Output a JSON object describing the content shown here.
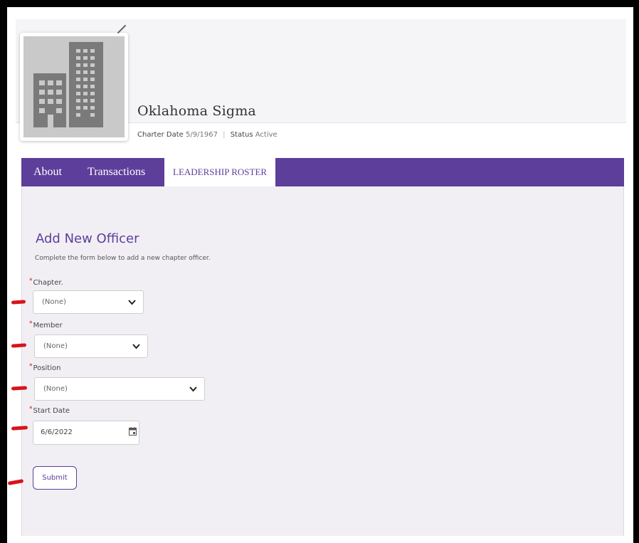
{
  "chapter": {
    "name": "Oklahoma Sigma",
    "charter_date_label": "Charter Date",
    "charter_date": "5/9/1967",
    "status_label": "Status",
    "status": "Active",
    "avatar_icon": "building-icon",
    "edit_icon": "pencil-icon"
  },
  "tabs": [
    {
      "label": "About",
      "active": false
    },
    {
      "label": "Transactions",
      "active": false
    },
    {
      "label": "LEADERSHIP ROSTER",
      "active": true
    }
  ],
  "form": {
    "title": "Add New Officer",
    "description": "Complete the form below to add a new chapter officer.",
    "required_marker": "*",
    "fields": {
      "chapter": {
        "label": "Chapter.",
        "value": "(None)"
      },
      "member": {
        "label": "Member",
        "value": "(None)"
      },
      "position": {
        "label": "Position",
        "value": "(None)"
      },
      "start_date": {
        "label": "Start Date",
        "value": "6/6/2022"
      }
    },
    "submit_label": "Submit"
  },
  "colors": {
    "brand_purple": "#5e3e9b",
    "panel_bg": "#f1eff4",
    "required_red": "#c2181a",
    "annotation_red": "#d8141b"
  }
}
